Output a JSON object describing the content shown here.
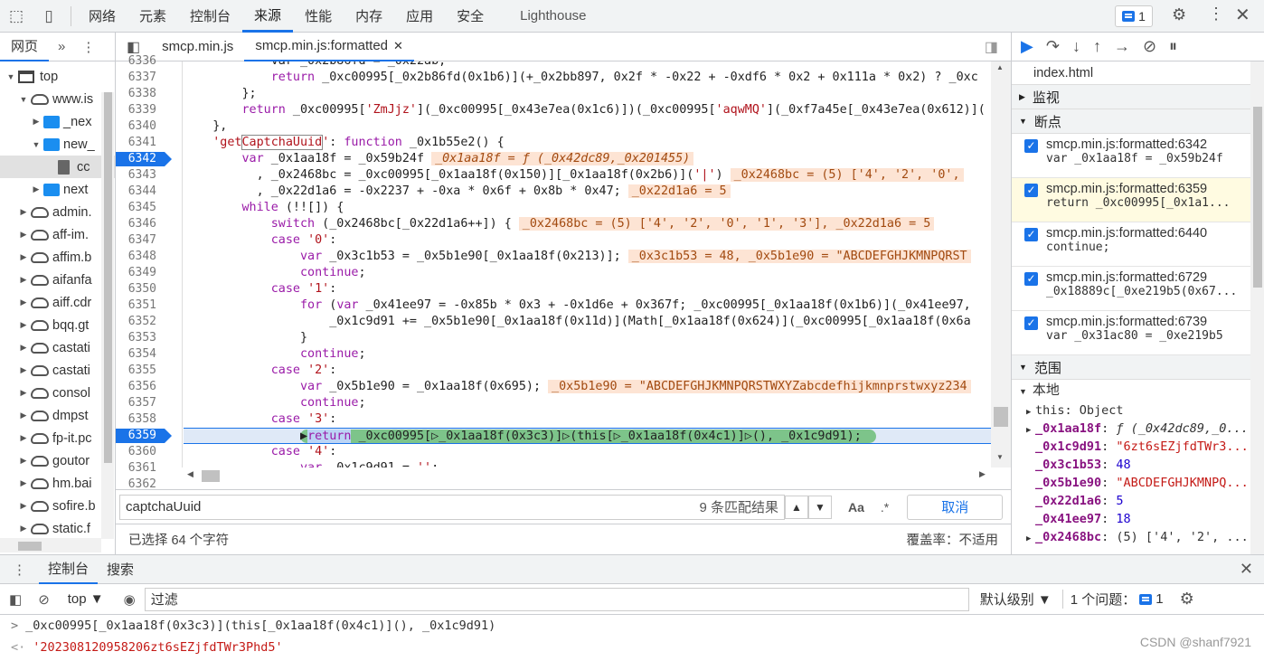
{
  "toolbar": {
    "tabs": [
      "网络",
      "元素",
      "控制台",
      "来源",
      "性能",
      "内存",
      "应用",
      "安全",
      "Lighthouse"
    ],
    "active_tab": "来源",
    "issues_count": "1"
  },
  "navigator": {
    "tab_page": "网页",
    "tree": [
      {
        "label": "top",
        "kind": "frame",
        "indent": 0,
        "arrow": "▼"
      },
      {
        "label": "www.is",
        "kind": "cloud",
        "indent": 1,
        "arrow": "▼"
      },
      {
        "label": "_nex",
        "kind": "folder",
        "indent": 2,
        "arrow": "▶"
      },
      {
        "label": "new_",
        "kind": "folder",
        "indent": 2,
        "arrow": "▼"
      },
      {
        "label": "cc",
        "kind": "file",
        "indent": 3,
        "arrow": ""
      },
      {
        "label": "next",
        "kind": "folder",
        "indent": 2,
        "arrow": "▶"
      },
      {
        "label": "admin.",
        "kind": "cloud",
        "indent": 1,
        "arrow": "▶"
      },
      {
        "label": "aff-im.",
        "kind": "cloud",
        "indent": 1,
        "arrow": "▶"
      },
      {
        "label": "affim.b",
        "kind": "cloud",
        "indent": 1,
        "arrow": "▶"
      },
      {
        "label": "aifanfa",
        "kind": "cloud",
        "indent": 1,
        "arrow": "▶"
      },
      {
        "label": "aiff.cdr",
        "kind": "cloud",
        "indent": 1,
        "arrow": "▶"
      },
      {
        "label": "bqq.gt",
        "kind": "cloud",
        "indent": 1,
        "arrow": "▶"
      },
      {
        "label": "castati",
        "kind": "cloud",
        "indent": 1,
        "arrow": "▶"
      },
      {
        "label": "castati",
        "kind": "cloud",
        "indent": 1,
        "arrow": "▶"
      },
      {
        "label": "consol",
        "kind": "cloud",
        "indent": 1,
        "arrow": "▶"
      },
      {
        "label": "dmpst",
        "kind": "cloud",
        "indent": 1,
        "arrow": "▶"
      },
      {
        "label": "fp-it.pc",
        "kind": "cloud",
        "indent": 1,
        "arrow": "▶"
      },
      {
        "label": "goutor",
        "kind": "cloud",
        "indent": 1,
        "arrow": "▶"
      },
      {
        "label": "hm.bai",
        "kind": "cloud",
        "indent": 1,
        "arrow": "▶"
      },
      {
        "label": "sofire.b",
        "kind": "cloud",
        "indent": 1,
        "arrow": "▶"
      },
      {
        "label": "static.f",
        "kind": "cloud",
        "indent": 1,
        "arrow": "▶"
      }
    ]
  },
  "editor": {
    "file_tabs": [
      "smcp.min.js",
      "smcp.min.js:formatted"
    ],
    "line_numbers": [
      "6336",
      "6337",
      "6338",
      "6339",
      "6340",
      "6341",
      "6342",
      "6343",
      "6344",
      "6345",
      "6346",
      "6347",
      "6348",
      "6349",
      "6350",
      "6351",
      "6352",
      "6353",
      "6354",
      "6355",
      "6356",
      "6357",
      "6358",
      "6359",
      "6360",
      "6361",
      "6362"
    ],
    "breakpoint_lines": [
      "6342",
      "6359"
    ],
    "search_value": "captchaUuid",
    "match_count": "9 条匹配结果",
    "match_case": "Aa",
    "regex": ".*",
    "cancel": "取消",
    "selection_status": "已选择 64 个字符",
    "coverage": "覆盖率：不适用"
  },
  "debugger": {
    "index_file": "index.html",
    "watch": "监视",
    "breakpoints_title": "断点",
    "breakpoints": [
      {
        "loc": "smcp.min.js:formatted:6342",
        "code": "var _0x1aa18f = _0x59b24f"
      },
      {
        "loc": "smcp.min.js:formatted:6359",
        "code": "return _0xc00995[_0x1a1..."
      },
      {
        "loc": "smcp.min.js:formatted:6440",
        "code": "continue;"
      },
      {
        "loc": "smcp.min.js:formatted:6729",
        "code": "_0x18889c[_0xe219b5(0x67..."
      },
      {
        "loc": "smcp.min.js:formatted:6739",
        "code": "var _0x31ac80 = _0xe219b5"
      }
    ],
    "scope_title": "范围",
    "local_title": "本地",
    "scope": [
      {
        "key": "this",
        "val": "Object",
        "type": "plain",
        "arrow": "▶"
      },
      {
        "key": "_0x1aa18f",
        "val": "ƒ (_0x42dc89,_0...",
        "type": "fn",
        "arrow": "▶"
      },
      {
        "key": "_0x1c9d91",
        "val": "\"6zt6sEZjfdTWr3...",
        "type": "str",
        "arrow": ""
      },
      {
        "key": "_0x3c1b53",
        "val": "48",
        "type": "num",
        "arrow": ""
      },
      {
        "key": "_0x5b1e90",
        "val": "\"ABCDEFGHJKMNPQ...",
        "type": "str",
        "arrow": ""
      },
      {
        "key": "_0x22d1a6",
        "val": "5",
        "type": "num",
        "arrow": ""
      },
      {
        "key": "_0x41ee97",
        "val": "18",
        "type": "num",
        "arrow": ""
      },
      {
        "key": "_0x2468bc",
        "val": "(5) ['4', '2', ...",
        "type": "plain",
        "arrow": "▶"
      }
    ]
  },
  "drawer": {
    "tab_console": "控制台",
    "tab_search": "搜索",
    "context": "top ▼",
    "filter_placeholder": "过滤",
    "levels": "默认级别 ▼",
    "issues": "1 个问题：",
    "issues_count": "1",
    "input_line": "_0xc00995[_0x1aa18f(0x3c3)](this[_0x1aa18f(0x4c1)](), _0x1c9d91)",
    "result": "'202308120958206zt6sEZjfdTWr3Phd5'",
    "watermark": "CSDN @shanf7921"
  }
}
